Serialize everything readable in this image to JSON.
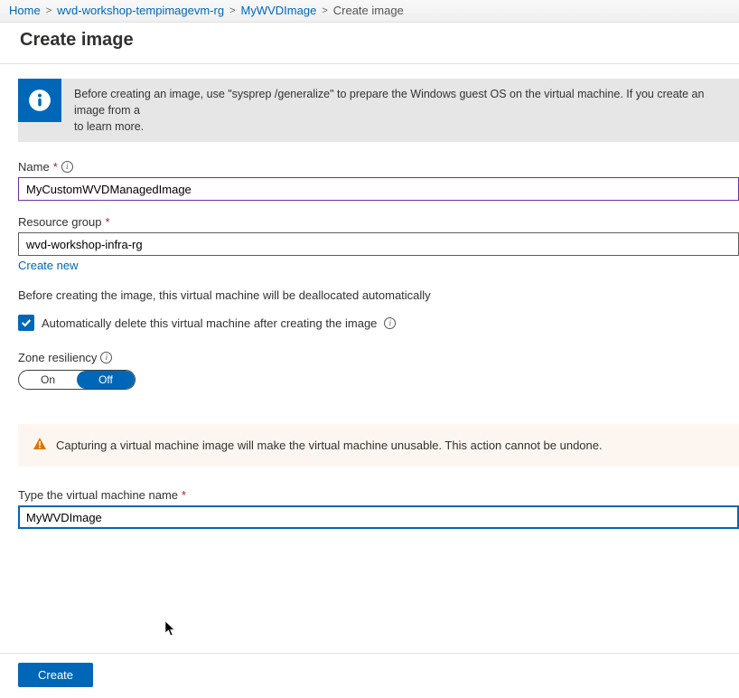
{
  "breadcrumb": {
    "items": [
      {
        "label": "Home"
      },
      {
        "label": "wvd-workshop-tempimagevm-rg"
      },
      {
        "label": "MyWVDImage"
      }
    ],
    "current": "Create image"
  },
  "page_title": "Create image",
  "info_banner": {
    "line1": "Before creating an image, use \"sysprep /generalize\" to prepare the Windows guest OS on the virtual machine. If you create an image from a",
    "line2": "to learn more."
  },
  "fields": {
    "name": {
      "label": "Name",
      "value": "MyCustomWVDManagedImage"
    },
    "resource_group": {
      "label": "Resource group",
      "value": "wvd-workshop-infra-rg",
      "create_new": "Create new"
    },
    "dealloc_note": "Before creating the image, this virtual machine will be deallocated automatically",
    "auto_delete": {
      "label": "Automatically delete this virtual machine after creating the image",
      "checked": true
    },
    "zone_resiliency": {
      "label": "Zone resiliency",
      "on": "On",
      "off": "Off",
      "value": "Off"
    },
    "warning": "Capturing a virtual machine image will make the virtual machine unusable. This action cannot be undone.",
    "vm_name": {
      "label": "Type the virtual machine name",
      "value": "MyWVDImage"
    }
  },
  "footer": {
    "create": "Create"
  }
}
